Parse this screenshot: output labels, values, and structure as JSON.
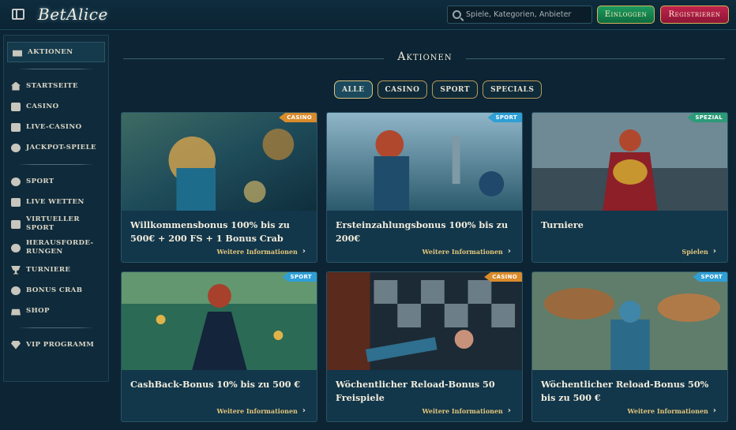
{
  "header": {
    "logo": "BetAlice",
    "search_placeholder": "Spiele, Kategorien, Anbieter",
    "login_label": "Einloggen",
    "register_label": "Registrieren"
  },
  "sidebar": {
    "active": "AKTIONEN",
    "group1": [
      "STARTSEITE",
      "CASINO",
      "LIVE-CASINO",
      "JACKPOT-SPIELE"
    ],
    "group2": [
      "SPORT",
      "LIVE WETTEN",
      "VIRTUELLER SPORT",
      "HERAUSFORDE-RUNGEN",
      "TURNIERE",
      "BONUS CRAB",
      "SHOP"
    ],
    "vip": "VIP PROGRAMM"
  },
  "main": {
    "title": "Aktionen",
    "filters": [
      "ALLE",
      "CASINO",
      "SPORT",
      "SPECIALS"
    ],
    "cards": [
      {
        "badge": "CASINO",
        "title": "Willkommensbonus 100% bis zu 500€ + 200 FS + 1 Bonus Crab",
        "link": "Weitere Informationen"
      },
      {
        "badge": "SPORT",
        "title": "Ersteinzahlungsbonus 100% bis zu 200€",
        "link": "Weitere Informationen"
      },
      {
        "badge": "SPEZIAL",
        "title": "Turniere",
        "link": "Spielen"
      },
      {
        "badge": "SPORT",
        "title": "CashBack-Bonus 10% bis zu 500 €",
        "link": "Weitere Informationen"
      },
      {
        "badge": "CASINO",
        "title": "Wöchentlicher Reload-Bonus 50 Freispiele",
        "link": "Weitere Informationen"
      },
      {
        "badge": "SPORT",
        "title": "Wöchentlicher Reload-Bonus 50% bis zu 500 €",
        "link": "Weitere Informationen"
      }
    ]
  },
  "colors": {
    "background": "#0c2433",
    "accent_gold": "#e2c579",
    "login_green": "#1d9b5e",
    "register_red": "#c0234c",
    "badge_casino": "#d98b2b",
    "badge_sport": "#2f9fd6",
    "badge_spezial": "#2c9b78"
  }
}
